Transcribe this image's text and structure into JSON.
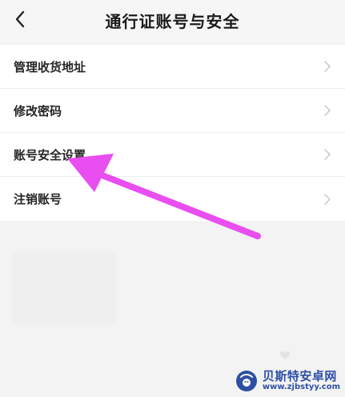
{
  "header": {
    "title": "通行证账号与安全",
    "back_icon": "chevron-left-icon"
  },
  "menu": {
    "items": [
      {
        "label": "管理收货地址",
        "icon": "chevron-right-icon"
      },
      {
        "label": "修改密码",
        "icon": "chevron-right-icon"
      },
      {
        "label": "账号安全设置",
        "icon": "chevron-right-icon"
      },
      {
        "label": "注销账号",
        "icon": "chevron-right-icon"
      }
    ]
  },
  "annotation": {
    "arrow_color": "#e84ef0"
  },
  "watermark": {
    "title": "贝斯特安卓网",
    "url": "www.zjbstyy.com",
    "brand_color": "#2d4fa3"
  }
}
